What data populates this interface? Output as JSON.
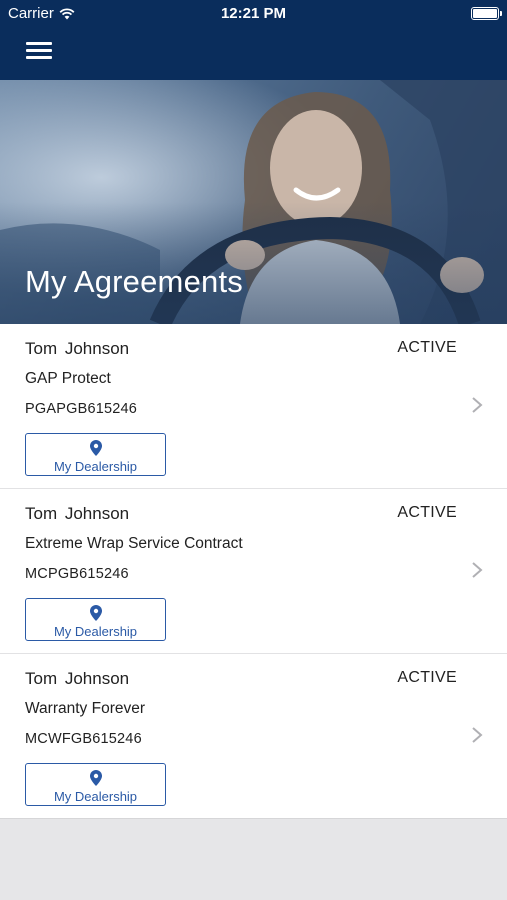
{
  "status_bar": {
    "carrier": "Carrier",
    "time": "12:21 PM"
  },
  "header": {
    "title": "My Agreements"
  },
  "agreements": [
    {
      "name": "Tom  Johnson",
      "status": "ACTIVE",
      "product": "GAP Protect",
      "contract_number": "PGAPGB615246",
      "dealer_button": "My Dealership"
    },
    {
      "name": "Tom  Johnson",
      "status": "ACTIVE",
      "product": "Extreme Wrap Service Contract",
      "contract_number": "MCPGB615246",
      "dealer_button": "My Dealership"
    },
    {
      "name": "Tom  Johnson",
      "status": "ACTIVE",
      "product": "Warranty Forever",
      "contract_number": "MCWFGB615246",
      "dealer_button": "My Dealership"
    }
  ],
  "colors": {
    "nav_bg": "#0a2d5c",
    "accent": "#2b5aa6",
    "background": "#e6e6e8"
  },
  "icons": [
    "wifi-icon",
    "battery-icon",
    "hamburger-menu-icon",
    "location-pin-icon",
    "chevron-right-icon"
  ]
}
